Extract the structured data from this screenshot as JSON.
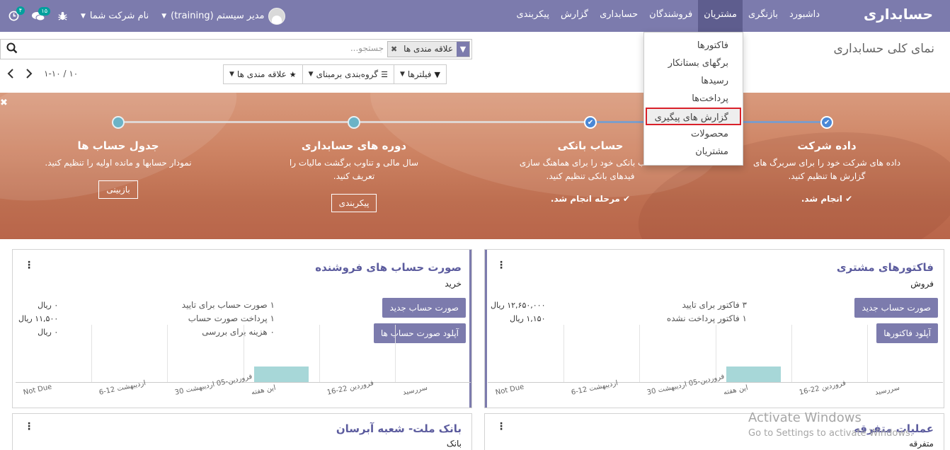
{
  "app": {
    "title": "حسابداری"
  },
  "menu": [
    {
      "label": "داشبورد"
    },
    {
      "label": "بازنگری"
    },
    {
      "label": "مشتریان"
    },
    {
      "label": "فروشندگان"
    },
    {
      "label": "حسابداری"
    },
    {
      "label": "گزارش"
    },
    {
      "label": "پیکربندی"
    }
  ],
  "menu_active": "مشتریان",
  "systray": {
    "activity_badge": "۴",
    "messages_badge": "۱۵",
    "company": "نام شرکت شما",
    "user": "مدیر سیستم (training)"
  },
  "dropdown": [
    {
      "label": "فاکتورها"
    },
    {
      "label": "برگهای بستانکار"
    },
    {
      "label": "رسیدها"
    },
    {
      "label": "پرداخت‌ها"
    },
    {
      "label": "گزارش های پیگیری"
    },
    {
      "label": "محصولات"
    },
    {
      "label": "مشتریان"
    }
  ],
  "control": {
    "title": "نمای کلی حسابداری",
    "facet": "علاقه مندی ها",
    "search_placeholder": "جستجو...",
    "filters": "فیلترها",
    "groupby": "گروه‌بندی برمبنای",
    "favorites": "علاقه مندی ها",
    "pager": "۱-۱۰ / ۱۰"
  },
  "onboarding": {
    "steps": [
      {
        "title": "داده شرکت",
        "desc": "داده های شرکت خود را برای سربرگ های گزارش ها تنظیم کنید.",
        "done": "انجام شد."
      },
      {
        "title": "حساب بانکی",
        "desc": "حساب بانکی خود را برای هماهنگ سازی فیدهای بانکی تنظیم کنید.",
        "done": "مرحله انجام شد."
      },
      {
        "title": "دوره های حسابداری",
        "desc": "سال مالی و تناوب برگشت مالیات را تعریف کنید.",
        "action": "پیکربندی"
      },
      {
        "title": "جدول حساب ها",
        "desc": "نمودار حسابها و مانده اولیه را تنظیم کنید.",
        "action": "بازبینی"
      }
    ]
  },
  "cards": [
    {
      "title": "فاکتورهای مشتری",
      "subtitle": "فروش",
      "btn_new": "صورت حساب جدید",
      "btn_upload": "آپلود فاکتورها",
      "stats": [
        "۳ فاکتور برای تایید",
        "۱ فاکتور پرداخت نشده"
      ],
      "amounts": [
        "۱۲,۶۵۰,۰۰۰ ریال",
        "۱,۱۵۰ ریال"
      ],
      "chart_labels": [
        "Not Due",
        "6-12 اردیبهشت",
        "30 فروردین-05 اردیبهشت",
        "این هفته",
        "16-22 فروردین",
        "سررسید"
      ]
    },
    {
      "title": "صورت حساب های فروشنده",
      "subtitle": "خرید",
      "btn_new": "صورت حساب جدید",
      "btn_upload": "آپلود صورت حساب ها",
      "stats": [
        "۱ صورت حساب برای تایید",
        "۱ پرداخت صورت حساب",
        "۰ هزینه برای بررسی"
      ],
      "amounts": [
        "۰ ریال",
        "۱۱,۵۰۰ ریال",
        "۰ ریال"
      ],
      "chart_labels": [
        "Not Due",
        "6-12 اردیبهشت",
        "30 فروردین-05 اردیبهشت",
        "این هفته",
        "16-22 فروردین",
        "سررسید"
      ]
    },
    {
      "title": "عملیات متفرقه",
      "subtitle": "متفرقه"
    },
    {
      "title": "بانک ملت- شعبه آبرسان",
      "subtitle": "بانک"
    }
  ],
  "chart_data": [
    {
      "type": "bar",
      "categories": [
        "Not Due",
        "6-12 اردیبهشت",
        "30 فروردین-05 اردیبهشت",
        "این هفته",
        "16-22 فروردین",
        "سررسید"
      ],
      "values": [
        0,
        0,
        0,
        1,
        0,
        0
      ]
    },
    {
      "type": "bar",
      "categories": [
        "Not Due",
        "6-12 اردیبهشت",
        "30 فروردین-05 اردیبهشت",
        "این هفته",
        "16-22 فروردین",
        "سررسید"
      ],
      "values": [
        0,
        0,
        0,
        1,
        0,
        0
      ]
    }
  ],
  "watermark": {
    "line1": "Activate Windows",
    "line2": "Go to Settings to activate Windows."
  },
  "colors": {
    "navbar": "#7c7bad",
    "navbar_active": "#5e5d8e",
    "primary_btn": "#7c7bad",
    "bar": "#a7d7d8",
    "highlight": "#d9202a"
  }
}
